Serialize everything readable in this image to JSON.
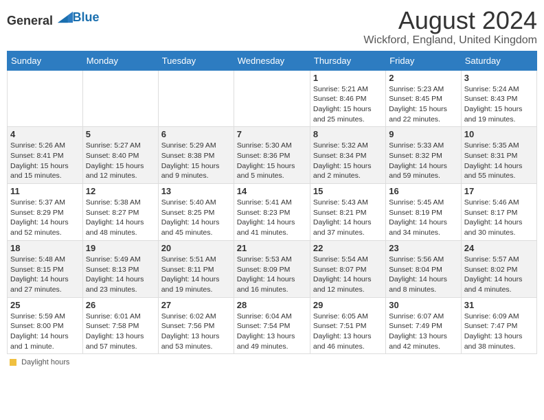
{
  "header": {
    "logo_general": "General",
    "logo_blue": "Blue",
    "title": "August 2024",
    "subtitle": "Wickford, England, United Kingdom"
  },
  "legend": {
    "label": "Daylight hours"
  },
  "days_of_week": [
    "Sunday",
    "Monday",
    "Tuesday",
    "Wednesday",
    "Thursday",
    "Friday",
    "Saturday"
  ],
  "weeks": [
    [
      {
        "num": "",
        "info": ""
      },
      {
        "num": "",
        "info": ""
      },
      {
        "num": "",
        "info": ""
      },
      {
        "num": "",
        "info": ""
      },
      {
        "num": "1",
        "info": "Sunrise: 5:21 AM\nSunset: 8:46 PM\nDaylight: 15 hours\nand 25 minutes."
      },
      {
        "num": "2",
        "info": "Sunrise: 5:23 AM\nSunset: 8:45 PM\nDaylight: 15 hours\nand 22 minutes."
      },
      {
        "num": "3",
        "info": "Sunrise: 5:24 AM\nSunset: 8:43 PM\nDaylight: 15 hours\nand 19 minutes."
      }
    ],
    [
      {
        "num": "4",
        "info": "Sunrise: 5:26 AM\nSunset: 8:41 PM\nDaylight: 15 hours\nand 15 minutes."
      },
      {
        "num": "5",
        "info": "Sunrise: 5:27 AM\nSunset: 8:40 PM\nDaylight: 15 hours\nand 12 minutes."
      },
      {
        "num": "6",
        "info": "Sunrise: 5:29 AM\nSunset: 8:38 PM\nDaylight: 15 hours\nand 9 minutes."
      },
      {
        "num": "7",
        "info": "Sunrise: 5:30 AM\nSunset: 8:36 PM\nDaylight: 15 hours\nand 5 minutes."
      },
      {
        "num": "8",
        "info": "Sunrise: 5:32 AM\nSunset: 8:34 PM\nDaylight: 15 hours\nand 2 minutes."
      },
      {
        "num": "9",
        "info": "Sunrise: 5:33 AM\nSunset: 8:32 PM\nDaylight: 14 hours\nand 59 minutes."
      },
      {
        "num": "10",
        "info": "Sunrise: 5:35 AM\nSunset: 8:31 PM\nDaylight: 14 hours\nand 55 minutes."
      }
    ],
    [
      {
        "num": "11",
        "info": "Sunrise: 5:37 AM\nSunset: 8:29 PM\nDaylight: 14 hours\nand 52 minutes."
      },
      {
        "num": "12",
        "info": "Sunrise: 5:38 AM\nSunset: 8:27 PM\nDaylight: 14 hours\nand 48 minutes."
      },
      {
        "num": "13",
        "info": "Sunrise: 5:40 AM\nSunset: 8:25 PM\nDaylight: 14 hours\nand 45 minutes."
      },
      {
        "num": "14",
        "info": "Sunrise: 5:41 AM\nSunset: 8:23 PM\nDaylight: 14 hours\nand 41 minutes."
      },
      {
        "num": "15",
        "info": "Sunrise: 5:43 AM\nSunset: 8:21 PM\nDaylight: 14 hours\nand 37 minutes."
      },
      {
        "num": "16",
        "info": "Sunrise: 5:45 AM\nSunset: 8:19 PM\nDaylight: 14 hours\nand 34 minutes."
      },
      {
        "num": "17",
        "info": "Sunrise: 5:46 AM\nSunset: 8:17 PM\nDaylight: 14 hours\nand 30 minutes."
      }
    ],
    [
      {
        "num": "18",
        "info": "Sunrise: 5:48 AM\nSunset: 8:15 PM\nDaylight: 14 hours\nand 27 minutes."
      },
      {
        "num": "19",
        "info": "Sunrise: 5:49 AM\nSunset: 8:13 PM\nDaylight: 14 hours\nand 23 minutes."
      },
      {
        "num": "20",
        "info": "Sunrise: 5:51 AM\nSunset: 8:11 PM\nDaylight: 14 hours\nand 19 minutes."
      },
      {
        "num": "21",
        "info": "Sunrise: 5:53 AM\nSunset: 8:09 PM\nDaylight: 14 hours\nand 16 minutes."
      },
      {
        "num": "22",
        "info": "Sunrise: 5:54 AM\nSunset: 8:07 PM\nDaylight: 14 hours\nand 12 minutes."
      },
      {
        "num": "23",
        "info": "Sunrise: 5:56 AM\nSunset: 8:04 PM\nDaylight: 14 hours\nand 8 minutes."
      },
      {
        "num": "24",
        "info": "Sunrise: 5:57 AM\nSunset: 8:02 PM\nDaylight: 14 hours\nand 4 minutes."
      }
    ],
    [
      {
        "num": "25",
        "info": "Sunrise: 5:59 AM\nSunset: 8:00 PM\nDaylight: 14 hours\nand 1 minute."
      },
      {
        "num": "26",
        "info": "Sunrise: 6:01 AM\nSunset: 7:58 PM\nDaylight: 13 hours\nand 57 minutes."
      },
      {
        "num": "27",
        "info": "Sunrise: 6:02 AM\nSunset: 7:56 PM\nDaylight: 13 hours\nand 53 minutes."
      },
      {
        "num": "28",
        "info": "Sunrise: 6:04 AM\nSunset: 7:54 PM\nDaylight: 13 hours\nand 49 minutes."
      },
      {
        "num": "29",
        "info": "Sunrise: 6:05 AM\nSunset: 7:51 PM\nDaylight: 13 hours\nand 46 minutes."
      },
      {
        "num": "30",
        "info": "Sunrise: 6:07 AM\nSunset: 7:49 PM\nDaylight: 13 hours\nand 42 minutes."
      },
      {
        "num": "31",
        "info": "Sunrise: 6:09 AM\nSunset: 7:47 PM\nDaylight: 13 hours\nand 38 minutes."
      }
    ]
  ]
}
